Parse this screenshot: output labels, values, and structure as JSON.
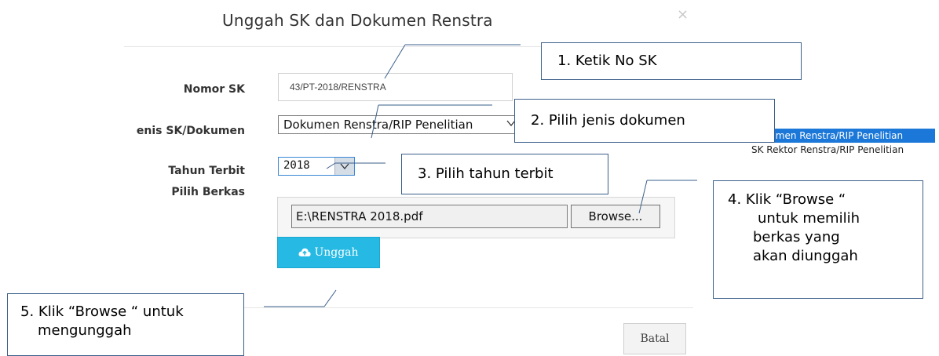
{
  "modal": {
    "title": "Unggah SK dan Dokumen Renstra",
    "close_glyph": "×"
  },
  "form": {
    "nomor_sk": {
      "label": "Nomor SK",
      "value": "43/PT-2018/RENSTRA"
    },
    "jenis": {
      "label": "enis SK/Dokumen",
      "value": "Dokumen Renstra/RIP Penelitian"
    },
    "jenis_options": [
      "Dokumen Renstra/RIP Penelitian",
      "SK Rektor Renstra/RIP Penelitian"
    ],
    "tahun": {
      "label": "Tahun Terbit",
      "value": "2018"
    },
    "berkas": {
      "label": "Pilih Berkas",
      "path": "E:\\RENSTRA 2018.pdf",
      "browse_label": "Browse..."
    }
  },
  "buttons": {
    "upload_label": "Unggah",
    "upload_icon": "cloud-upload-icon",
    "cancel_label": "Batal"
  },
  "callouts": {
    "c1": "1. Ketik No SK",
    "c2": "2. Pilih jenis dokumen",
    "c3": "3. Pilih tahun terbit",
    "c4_line1": "4. Klik “Browse “",
    "c4_line2": "untuk memilih",
    "c4_line3": "berkas yang",
    "c4_line4": "akan diunggah",
    "c5_line1": "5. Klik “Browse “ untuk",
    "c5_line2": "mengunggah"
  },
  "colors": {
    "upload_button": "#25b9e3",
    "dropdown_selected": "#1c78d8",
    "callout_border": "#3a5f8a"
  }
}
